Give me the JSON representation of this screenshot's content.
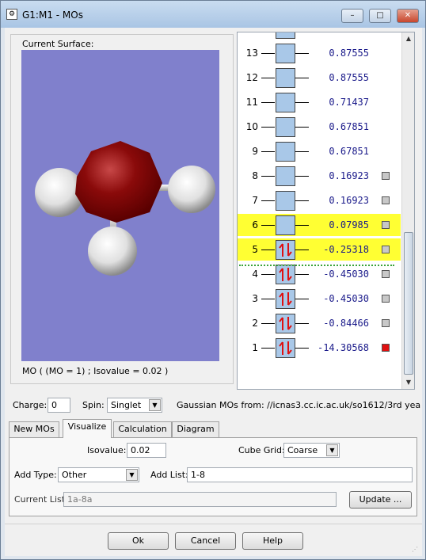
{
  "window": {
    "title": "G1:M1 - MOs",
    "icon_glyph": "⚙",
    "minimize_glyph": "–",
    "maximize_glyph": "□",
    "close_glyph": "✕"
  },
  "surface": {
    "legend": "Current Surface:",
    "caption": "MO ( (MO = 1) ; Isovalue = 0.02 )",
    "background_color": "#8080cc"
  },
  "orbitals": [
    {
      "number": "",
      "energy": "",
      "occupied": false,
      "checkbox": false,
      "highlight": false
    },
    {
      "number": "13",
      "energy": "0.87555",
      "occupied": false,
      "checkbox": false,
      "highlight": false
    },
    {
      "number": "12",
      "energy": "0.87555",
      "occupied": false,
      "checkbox": false,
      "highlight": false
    },
    {
      "number": "11",
      "energy": "0.71437",
      "occupied": false,
      "checkbox": false,
      "highlight": false
    },
    {
      "number": "10",
      "energy": "0.67851",
      "occupied": false,
      "checkbox": false,
      "highlight": false
    },
    {
      "number": "9",
      "energy": "0.67851",
      "occupied": false,
      "checkbox": false,
      "highlight": false
    },
    {
      "number": "8",
      "energy": "0.16923",
      "occupied": false,
      "checkbox": true,
      "highlight": false
    },
    {
      "number": "7",
      "energy": "0.16923",
      "occupied": false,
      "checkbox": true,
      "highlight": false
    },
    {
      "number": "6",
      "energy": "0.07985",
      "occupied": false,
      "checkbox": true,
      "highlight": true
    },
    {
      "number": "5",
      "energy": "-0.25318",
      "occupied": true,
      "checkbox": true,
      "highlight": true
    },
    {
      "number": "4",
      "energy": "-0.45030",
      "occupied": true,
      "checkbox": true,
      "highlight": false
    },
    {
      "number": "3",
      "energy": "-0.45030",
      "occupied": true,
      "checkbox": true,
      "highlight": false
    },
    {
      "number": "2",
      "energy": "-0.84466",
      "occupied": true,
      "checkbox": true,
      "highlight": false
    },
    {
      "number": "1",
      "energy": "-14.30568",
      "occupied": true,
      "checkbox": true,
      "highlight": false,
      "checked_red": true
    }
  ],
  "charge": {
    "label": "Charge:",
    "value": "0"
  },
  "spin": {
    "label": "Spin:",
    "value": "Singlet"
  },
  "source": {
    "text": "Gaussian MOs from:  //icnas3.cc.ic.ac.uk/so1612/3rd yea"
  },
  "tabs": [
    {
      "label": "New MOs"
    },
    {
      "label": "Visualize"
    },
    {
      "label": "Calculation"
    },
    {
      "label": "Diagram"
    }
  ],
  "visualize": {
    "isovalue_label": "Isovalue:",
    "isovalue": "0.02",
    "cube_grid_label": "Cube Grid:",
    "cube_grid": "Coarse",
    "add_type_label": "Add Type:",
    "add_type": "Other",
    "add_list_label": "Add List:",
    "add_list": "1-8",
    "current_list_label": "Current List:",
    "current_list": "1a-8a",
    "update_label": "Update ..."
  },
  "buttons": {
    "ok": "Ok",
    "cancel": "Cancel",
    "help": "Help"
  },
  "colors": {
    "highlight": "#ffff33",
    "homo_lumo_line": "#3aa33a",
    "orbital_box": "#a9c8e8",
    "energy_text": "#1a1a8a",
    "electron_arrow": "#e01010"
  }
}
